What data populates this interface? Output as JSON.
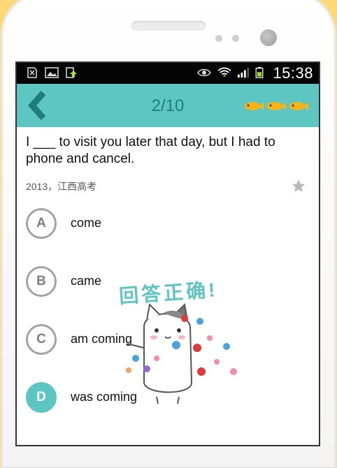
{
  "status_bar": {
    "time": "15:38"
  },
  "header": {
    "progress": "2/10"
  },
  "question": {
    "text": "I ___ to visit you later that day, but I had to phone and cancel.",
    "source": "2013，江西高考"
  },
  "options": [
    {
      "letter": "A",
      "text": "come"
    },
    {
      "letter": "B",
      "text": "came"
    },
    {
      "letter": "C",
      "text": "am coming"
    },
    {
      "letter": "D",
      "text": "was coming",
      "selected": true
    }
  ],
  "feedback": {
    "text": "回答正确!"
  },
  "colors": {
    "accent": "#5dc6c3",
    "accent_dark": "#1f7e7d",
    "background": "#fdd978"
  }
}
